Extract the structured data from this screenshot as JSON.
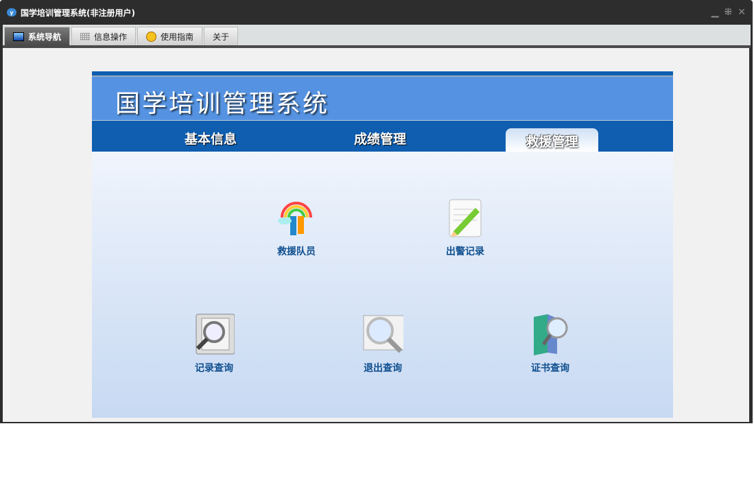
{
  "window": {
    "title": "国学培训管理系统(非注册用户)"
  },
  "tabs": [
    {
      "label": "系统导航"
    },
    {
      "label": "信息操作"
    },
    {
      "label": "使用指南"
    },
    {
      "label": "关于"
    }
  ],
  "banner": {
    "title": "国学培训管理系统"
  },
  "nav": [
    {
      "label": "基本信息"
    },
    {
      "label": "成绩管理"
    },
    {
      "label": "救援管理"
    }
  ],
  "items": [
    {
      "label": "救援队员"
    },
    {
      "label": "出警记录"
    },
    {
      "label": "记录查询"
    },
    {
      "label": "退出查询"
    },
    {
      "label": "证书查询"
    }
  ]
}
